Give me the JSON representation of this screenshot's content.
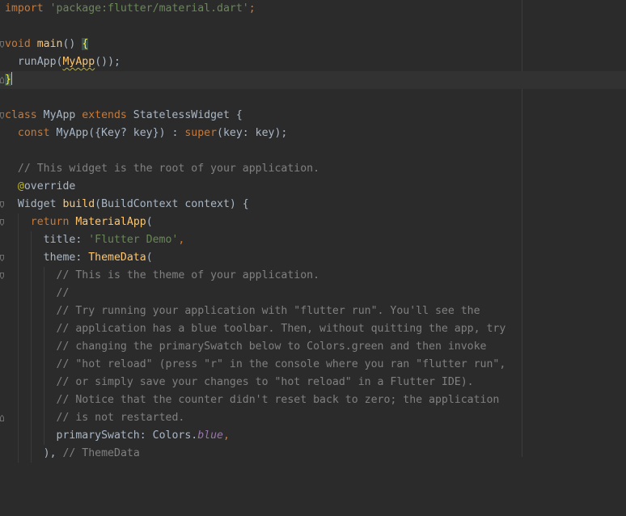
{
  "editor": {
    "code": {
      "import_kw": "import",
      "import_path": "'package:flutter/material.dart'",
      "semicolon": ";",
      "void_kw": "void",
      "main_fn": "main",
      "main_parens": "() ",
      "open_brace": "{",
      "run_app_fn": "runApp",
      "run_app_open": "(",
      "my_app_call": "MyApp",
      "run_app_close": "());",
      "close_brace": "}",
      "class_kw": "class",
      "class_name": " MyApp ",
      "extends_kw": "extends",
      "superclass": " StatelessWidget {",
      "const_kw": "const",
      "ctor_params": " MyApp({Key? key}) : ",
      "super_kw": "super",
      "super_args": "(key: key);",
      "comment_root": "// This widget is the root of your application.",
      "override_at": "@",
      "override_name": "override",
      "widget_type": "Widget ",
      "build_fn": "build",
      "build_params": "(BuildContext context) {",
      "return_kw": "return",
      "material_app_fn": "MaterialApp",
      "material_app_open": "(",
      "title_key": "title: ",
      "title_value": "'Flutter Demo'",
      "comma": ",",
      "theme_key": "theme: ",
      "theme_data_fn": "ThemeData",
      "theme_data_open": "(",
      "comment_1": "// This is the theme of your application.",
      "comment_2": "//",
      "comment_3": "// Try running your application with \"flutter run\". You'll see the",
      "comment_4": "// application has a blue toolbar. Then, without quitting the app, try",
      "comment_5": "// changing the primarySwatch below to Colors.green and then invoke",
      "comment_6": "// \"hot reload\" (press \"r\" in the console where you ran \"flutter run\",",
      "comment_7": "// or simply save your changes to \"hot reload\" in a Flutter IDE).",
      "comment_8": "// Notice that the counter didn't reset back to zero; the application",
      "comment_9": "// is not restarted.",
      "swatch_key": "primarySwatch: Colors.",
      "swatch_value": "blue",
      "swatch_comma": ",",
      "theme_close": "),",
      "theme_close_comment": "// ThemeData"
    },
    "colors": {
      "background": "#2b2b2b",
      "keyword": "#cc7832",
      "string": "#6a8759",
      "function": "#ffc66d",
      "comment": "#808080",
      "annotation": "#bbb529",
      "constant": "#9876aa",
      "text": "#a9b7c6"
    },
    "icons": {
      "fold_marker": "fold-marker-icon"
    }
  }
}
